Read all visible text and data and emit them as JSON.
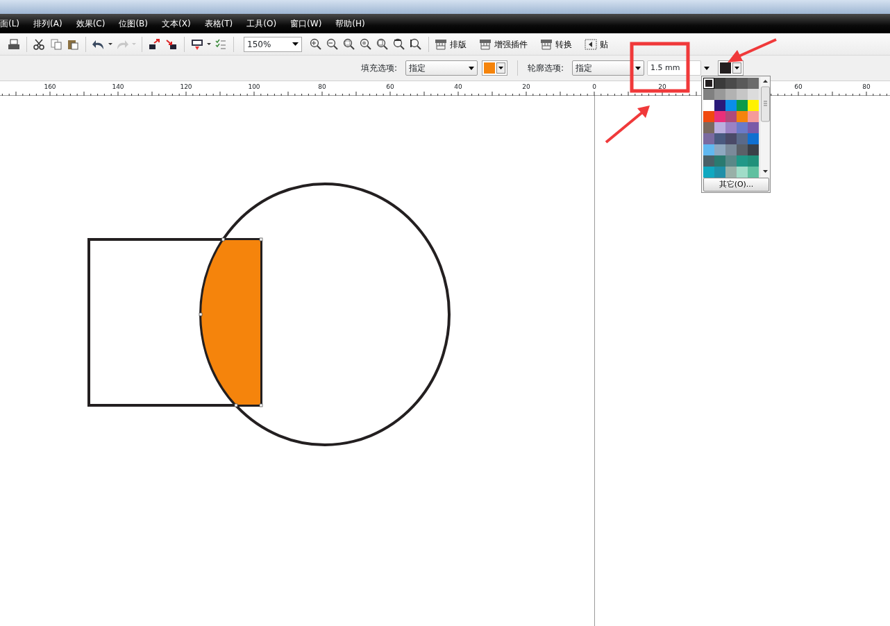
{
  "menu": [
    {
      "label": "面(L)"
    },
    {
      "label": "排列(A)"
    },
    {
      "label": "效果(C)"
    },
    {
      "label": "位图(B)"
    },
    {
      "label": "文本(X)"
    },
    {
      "label": "表格(T)"
    },
    {
      "label": "工具(O)"
    },
    {
      "label": "窗口(W)"
    },
    {
      "label": "帮助(H)"
    }
  ],
  "toolbar": {
    "undo": {
      "disabled": false
    },
    "redo": {
      "disabled": true
    },
    "zoom": "150%",
    "buttons": [
      {
        "label": "排版",
        "kind": "layout"
      },
      {
        "label": "增强插件",
        "kind": "layout"
      },
      {
        "label": "转换",
        "kind": "layout"
      },
      {
        "label": "贴",
        "kind": "snap"
      }
    ]
  },
  "property_bar": {
    "fill": {
      "label": "填充选项:",
      "mode": "指定",
      "color": "#f5840c"
    },
    "outline": {
      "label": "轮廓选项:",
      "mode": "指定",
      "width": "1.5 mm",
      "color": "#231f20"
    }
  },
  "ruler": {
    "labels": [
      "160",
      "140",
      "120",
      "100",
      "80",
      "60",
      "40",
      "20",
      "0",
      "20",
      "60",
      "80"
    ]
  },
  "palette": {
    "swatches": [
      {
        "color": "#231f20",
        "selected": true
      },
      {
        "color": "#3a3a3a",
        "selected": false
      },
      {
        "color": "#4a4a4a",
        "selected": false
      },
      {
        "color": "#5a5a5a",
        "selected": false
      },
      {
        "color": "#6b6b6b",
        "selected": false
      },
      {
        "color": "#808080",
        "selected": false
      },
      {
        "color": "#999999",
        "selected": false
      },
      {
        "color": "#b2b2b2",
        "selected": false
      },
      {
        "color": "#c6c6c6",
        "selected": false
      },
      {
        "color": "#dcdcdc",
        "selected": false
      },
      {
        "color": "#ffffff",
        "selected": false
      },
      {
        "color": "#2a1a7a",
        "selected": false
      },
      {
        "color": "#0a8ee8",
        "selected": false
      },
      {
        "color": "#0a9a4a",
        "selected": false
      },
      {
        "color": "#fff200",
        "selected": false
      },
      {
        "color": "#f04a10",
        "selected": false
      },
      {
        "color": "#ea2f7a",
        "selected": false
      },
      {
        "color": "#b04a7a",
        "selected": false
      },
      {
        "color": "#f5840c",
        "selected": false
      },
      {
        "color": "#f59a9a",
        "selected": false
      },
      {
        "color": "#7a6a60",
        "selected": false
      },
      {
        "color": "#baaede",
        "selected": false
      },
      {
        "color": "#9a82c4",
        "selected": false
      },
      {
        "color": "#6a7ac8",
        "selected": false
      },
      {
        "color": "#7a5aa8",
        "selected": false
      },
      {
        "color": "#7a6aa0",
        "selected": false
      },
      {
        "color": "#4a5a80",
        "selected": false
      },
      {
        "color": "#4a4a68",
        "selected": false
      },
      {
        "color": "#5a6a8a",
        "selected": false
      },
      {
        "color": "#1070d0",
        "selected": false
      },
      {
        "color": "#60b8f0",
        "selected": false
      },
      {
        "color": "#8ea8c0",
        "selected": false
      },
      {
        "color": "#7a8a9a",
        "selected": false
      },
      {
        "color": "#5a6068",
        "selected": false
      },
      {
        "color": "#3a4048",
        "selected": false
      },
      {
        "color": "#4a6068",
        "selected": false
      },
      {
        "color": "#2a7a70",
        "selected": false
      },
      {
        "color": "#5a8888",
        "selected": false
      },
      {
        "color": "#209888",
        "selected": false
      },
      {
        "color": "#20907a",
        "selected": false
      },
      {
        "color": "#10a8c0",
        "selected": false
      },
      {
        "color": "#2090a8",
        "selected": false
      },
      {
        "color": "#98b0a8",
        "selected": false
      },
      {
        "color": "#a0dcc8",
        "selected": false
      },
      {
        "color": "#60c0a0",
        "selected": false
      }
    ],
    "more_button": "其它(O)..."
  }
}
